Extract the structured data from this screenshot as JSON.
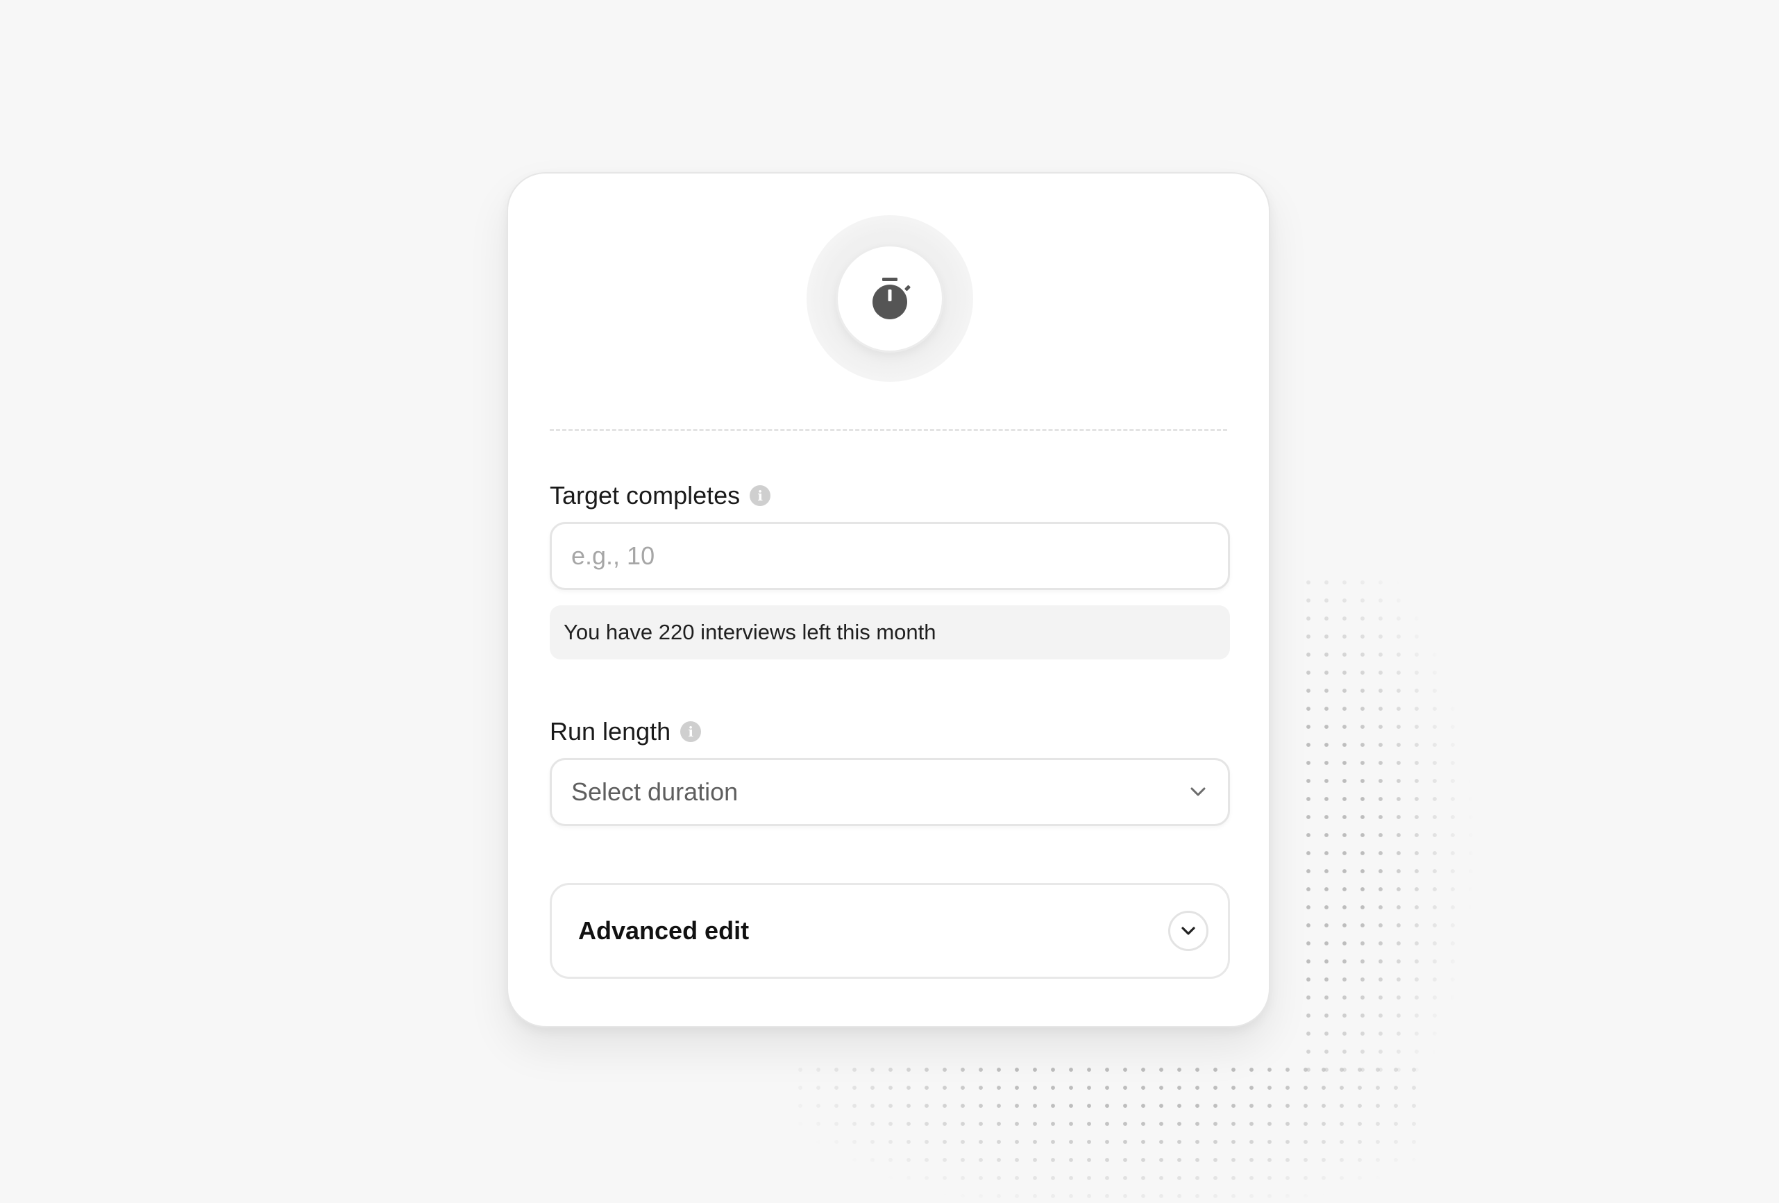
{
  "target_completes": {
    "label": "Target completes",
    "placeholder": "e.g., 10",
    "value": "",
    "quota_note": "You have 220 interviews left this month"
  },
  "run_length": {
    "label": "Run length",
    "selected": "Select duration"
  },
  "advanced_edit": {
    "label": "Advanced edit"
  },
  "icons": {
    "header": "stopwatch-icon",
    "info": "info-icon",
    "select_chevron": "chevron-down-icon",
    "advanced_chevron": "chevron-down-icon"
  },
  "colors": {
    "background": "#f7f7f7",
    "card": "#ffffff",
    "icon": "#555555",
    "placeholder": "#a6a6a6"
  }
}
